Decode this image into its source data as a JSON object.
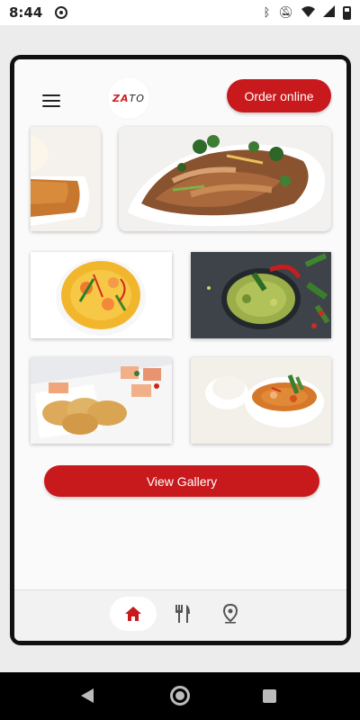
{
  "status_bar": {
    "time": "8:44",
    "icons": [
      "app-notification-icon",
      "bluetooth-icon",
      "mute-icon",
      "wifi-icon",
      "signal-icon",
      "battery-icon"
    ]
  },
  "header": {
    "menu_icon": "hamburger-icon",
    "logo_text_prefix": "ZA",
    "logo_text_suffix": "TO",
    "order_button": "Order online"
  },
  "gallery": {
    "images": [
      {
        "name": "sauce-dish-image"
      },
      {
        "name": "stir-fried-noodles-image"
      },
      {
        "name": "yellow-curry-image"
      },
      {
        "name": "green-curry-image"
      },
      {
        "name": "dumplings-image"
      },
      {
        "name": "red-curry-with-rice-image"
      }
    ],
    "view_button": "View Gallery"
  },
  "tabbar": {
    "tabs": [
      {
        "name": "home",
        "icon": "home-icon",
        "active": true
      },
      {
        "name": "menu",
        "icon": "fork-knife-icon",
        "active": false
      },
      {
        "name": "location",
        "icon": "location-pin-icon",
        "active": false
      }
    ],
    "active_color": "#c8191c",
    "inactive_color": "#555555"
  },
  "colors": {
    "accent": "#c8191c"
  }
}
